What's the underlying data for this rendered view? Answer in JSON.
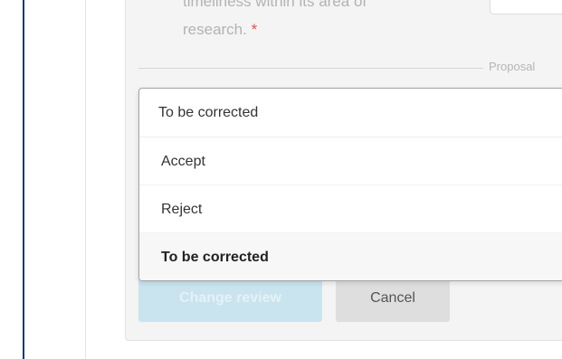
{
  "question": {
    "line1": "timeliness within its area of",
    "line2": "research.",
    "required_marker": "*"
  },
  "section_divider": {
    "label": "Proposal"
  },
  "review_select": {
    "selected_value": "To be corrected",
    "options": [
      {
        "label": "Accept"
      },
      {
        "label": "Reject"
      },
      {
        "label": "To be corrected"
      }
    ]
  },
  "buttons": {
    "change_review": "Change review",
    "cancel": "Cancel"
  },
  "colors": {
    "primary_disabled": "#c9e4ee",
    "secondary_button": "#dedede",
    "required_star": "#e5533d",
    "page_left_border": "#1f3a66"
  }
}
